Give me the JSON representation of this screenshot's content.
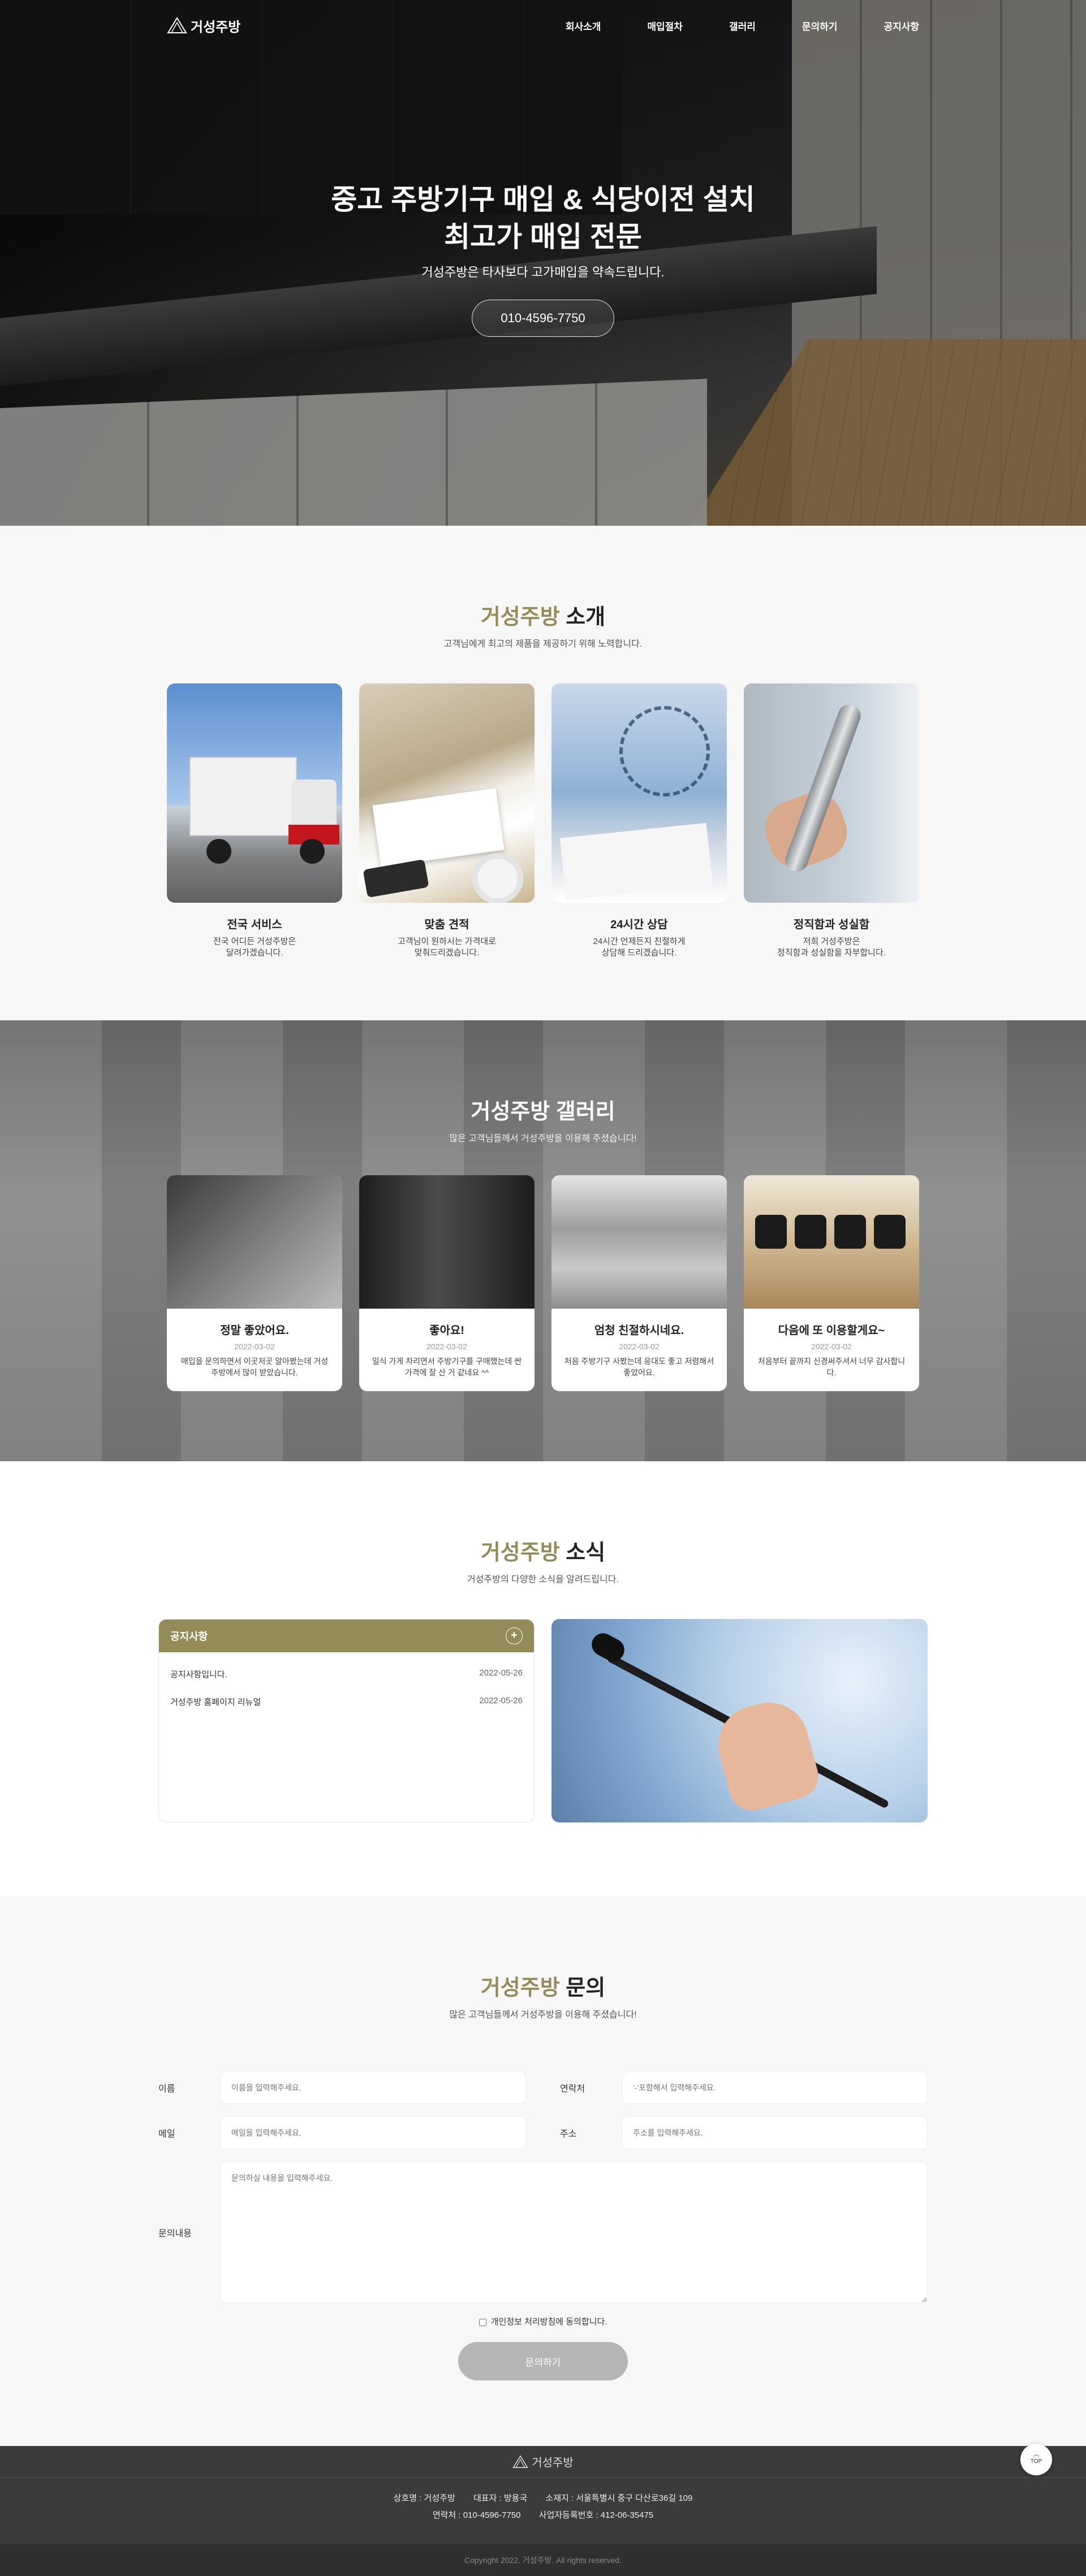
{
  "brand": {
    "name": "거성주방"
  },
  "nav": {
    "items": [
      "회사소개",
      "매입절차",
      "갤러리",
      "문의하기",
      "공지사항"
    ]
  },
  "hero": {
    "title_line1": "중고 주방기구 매입 & 식당이전 설치",
    "title_line2": "최고가 매입 전문",
    "subtitle": "거성주방은 타사보다 고가매입을 약속드립니다.",
    "phone": "010-4596-7750"
  },
  "about": {
    "title_accent": "거성주방",
    "title_rest": " 소개",
    "subtitle": "고객님에게 최고의 제품을 제공하기 위해 노력합니다.",
    "cards": [
      {
        "title": "전국 서비스",
        "desc": "전국 어디든 거성주방은\n달려가겠습니다."
      },
      {
        "title": "맞춤 견적",
        "desc": "고객님이 원하시는 가격대로\n맞춰드리겠습니다."
      },
      {
        "title": "24시간 상담",
        "desc": "24시간 언제든지 친절하게\n상담해 드리겠습니다."
      },
      {
        "title": "정직함과 성실함",
        "desc": "저희 거성주방은\n정직함과 성실함을 자부합니다."
      }
    ]
  },
  "gallery": {
    "title": "거성주방 갤러리",
    "subtitle": "많은 고객님들께서 거성주방을 이용해 주셨습니다!",
    "cards": [
      {
        "title": "정말 좋았어요.",
        "date": "2022-03-02",
        "desc": "매입을 문의하면서 이곳저곳 알아봤는데 거성주방에서 많이 받았습니다."
      },
      {
        "title": "좋아요!",
        "date": "2022-03-02",
        "desc": "일식 가게 차리면서 주방기구를 구매했는데 싼 가격에 잘 산 거 같네요 ^^"
      },
      {
        "title": "엄청 친절하시네요.",
        "date": "2022-03-02",
        "desc": "처음 주방기구 사봤는데 응대도 좋고 저렴해서 좋았어요."
      },
      {
        "title": "다음에 또 이용할게요~",
        "date": "2022-03-02",
        "desc": "처음부터 끝까지 신경써주셔서 너무 감사합니다."
      }
    ]
  },
  "news": {
    "title_accent": "거성주방",
    "title_rest": " 소식",
    "subtitle": "거성주방의 다양한 소식을 알려드립니다.",
    "board_title": "공지사항",
    "plus": "+",
    "items": [
      {
        "title": "공지사항입니다.",
        "date": "2022-05-26"
      },
      {
        "title": "거성주방 홈페이지 리뉴얼",
        "date": "2022-05-26"
      }
    ]
  },
  "inquiry": {
    "title_accent": "거성주방",
    "title_rest": " 문의",
    "subtitle": "많은 고객님들께서 거성주방을 이용해 주셨습니다!",
    "fields": {
      "name": {
        "label": "이름",
        "placeholder": "이름을 입력해주세요."
      },
      "phone": {
        "label": "연락처",
        "placeholder": "'-'포함해서 입력해주세요."
      },
      "email": {
        "label": "메일",
        "placeholder": "메일을 입력해주세요."
      },
      "address": {
        "label": "주소",
        "placeholder": "주소를 입력해주세요."
      },
      "content": {
        "label": "문의내용",
        "placeholder": "문의하실 내용을 입력해주세요."
      }
    },
    "agree": "개인정보 처리방침에 동의합니다.",
    "submit": "문의하기"
  },
  "footer": {
    "company": "상호명 : 거성주방",
    "ceo": "대표자 : 방용국",
    "address": "소재지 : 서울특별시 중구 다산로36길 109",
    "phone": "연락처 : 010-4596-7750",
    "biz_no": "사업자등록번호 : 412-06-35475",
    "copyright": "Copyright 2022. 거성주방. All rights reserved.",
    "top": "TOP"
  },
  "colors": {
    "accent": "#948c58",
    "footer": "#3b3b3b"
  }
}
